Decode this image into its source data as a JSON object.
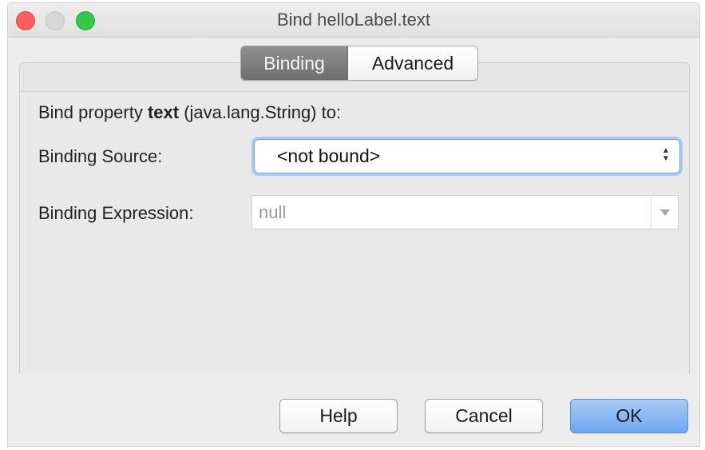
{
  "window": {
    "title": "Bind helloLabel.text"
  },
  "tabs": [
    {
      "label": "Binding",
      "active": true
    },
    {
      "label": "Advanced",
      "active": false
    }
  ],
  "binding": {
    "property_prefix": "Bind property ",
    "property_name": "text",
    "property_suffix": " (java.lang.String) to:",
    "source_label": "Binding Source:",
    "source_value": "<not bound>",
    "expression_label": "Binding Expression:",
    "expression_value": "null"
  },
  "buttons": {
    "help": "Help",
    "cancel": "Cancel",
    "ok": "OK"
  },
  "colors": {
    "close": "#fc5f57",
    "minimize": "#d7d7d7",
    "maximize": "#34c84a",
    "default_button": "#6ea6ef",
    "focus_ring": "#a9c8f3"
  },
  "icons": {
    "select_arrows": "updown-arrows-icon",
    "combo_arrow": "triangle-down-icon"
  }
}
